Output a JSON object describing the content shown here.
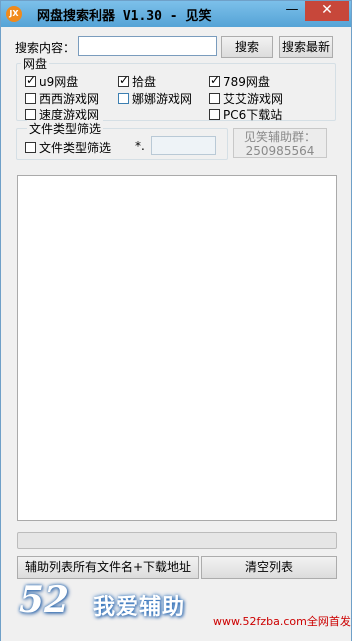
{
  "window": {
    "icon_text": "JX",
    "title": "网盘搜索利器 V1.30 - 见笑",
    "minimize_glyph": "—",
    "close_glyph": "✕"
  },
  "search": {
    "label": "搜索内容：",
    "value": "",
    "search_button": "搜索",
    "latest_button": "搜索最新"
  },
  "netdisk_group": {
    "title": "网盘",
    "items": [
      {
        "label": "u9网盘",
        "checked": true
      },
      {
        "label": "拾盘",
        "checked": true
      },
      {
        "label": "789网盘",
        "checked": true
      },
      {
        "label": "西西游戏网",
        "checked": false
      },
      {
        "label": "娜娜游戏网",
        "checked": false
      },
      {
        "label": "艾艾游戏网",
        "checked": false
      },
      {
        "label": "速度游戏网",
        "checked": false
      },
      {
        "label": "PC6下载站",
        "checked": false
      }
    ]
  },
  "filetype_group": {
    "title": "文件类型筛选",
    "checkbox_label": "文件类型筛选",
    "checked": false,
    "ext_prefix": "*.",
    "ext_value": ""
  },
  "donate": {
    "line1": "见笑辅助群：",
    "line2": "250985564"
  },
  "progress": {
    "value": 0
  },
  "buttons": {
    "copy_list": "辅助列表所有文件名+下载地址",
    "clear_list": "清空列表"
  },
  "footer": {
    "big_number": "52",
    "brand": "我爱辅助",
    "site": "www.52fzba.com全网首发"
  },
  "colors": {
    "titlebar": "#5aa8dc",
    "close_button": "#c7473a",
    "site_text": "#cc0000"
  }
}
